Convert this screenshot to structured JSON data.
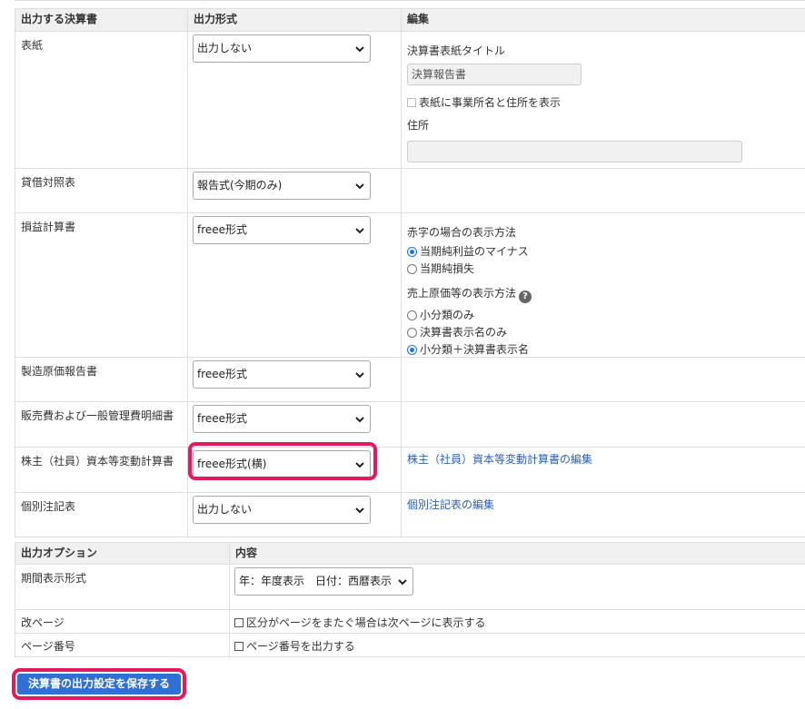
{
  "reports_table": {
    "headers": {
      "report": "出力する決算書",
      "format": "出力形式",
      "edit": "編集"
    },
    "rows": [
      {
        "name": "表紙",
        "format": "出力しない"
      },
      {
        "name": "貸借対照表",
        "format": "報告式(今期のみ)"
      },
      {
        "name": "損益計算書",
        "format": "freee形式"
      },
      {
        "name": "製造原価報告書",
        "format": "freee形式"
      },
      {
        "name": "販売費および一般管理費明細書",
        "format": "freee形式"
      },
      {
        "name": "株主（社員）資本等変動計算書",
        "format": "freee形式(横)"
      },
      {
        "name": "個別注記表",
        "format": "出力しない"
      }
    ],
    "cover_edit": {
      "title_label": "決算書表紙タイトル",
      "title_value": "決算報告書",
      "show_address_label": "表紙に事業所名と住所を表示",
      "address_label": "住所",
      "address_value": ""
    },
    "pl_edit": {
      "deficit_label": "赤字の場合の表示方法",
      "deficit_options": [
        "当期純利益のマイナス",
        "当期純損失"
      ],
      "cogs_label": "売上原価等の表示方法",
      "cogs_options": [
        "小分類のみ",
        "決算書表示名のみ",
        "小分類＋決算書表示名"
      ]
    },
    "equity_edit_link": "株主（社員）資本等変動計算書の編集",
    "notes_edit_link": "個別注記表の編集"
  },
  "options_table": {
    "headers": {
      "option": "出力オプション",
      "content": "内容"
    },
    "period_label": "期間表示形式",
    "period_value": "年：年度表示　日付：西暦表示",
    "page_break_label": "改ページ",
    "page_break_text": "区分がページをまたぐ場合は次ページに表示する",
    "page_number_label": "ページ番号",
    "page_number_text": "ページ番号を出力する"
  },
  "save_button": "決算書の出力設定を保存する",
  "colors": {
    "highlight": "#e5195e",
    "button": "#2f6fd6",
    "link": "#2a5fb8"
  }
}
